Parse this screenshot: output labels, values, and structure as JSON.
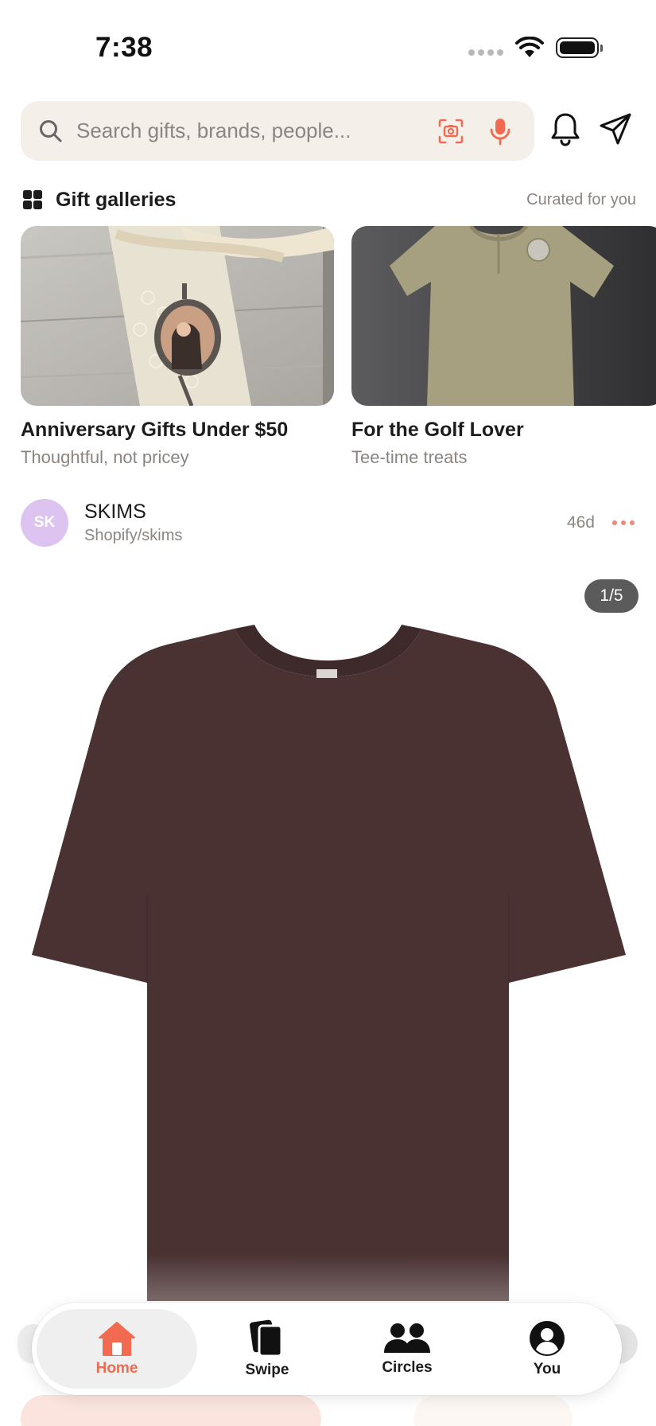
{
  "status_bar": {
    "time": "7:38"
  },
  "search": {
    "placeholder": "Search gifts, brands, people..."
  },
  "galleries": {
    "title": "Gift galleries",
    "subtitle": "Curated for you",
    "cards": [
      {
        "title": "Anniversary Gifts Under $50",
        "subtitle": "Thoughtful, not pricey"
      },
      {
        "title": "For the Golf Lover",
        "subtitle": "Tee-time treats"
      }
    ]
  },
  "post": {
    "avatar_initials": "SK",
    "name": "SKIMS",
    "handle": "Shopify/skims",
    "age": "46d",
    "image_counter": "1/5"
  },
  "bottom_nav": {
    "items": [
      {
        "label": "Home",
        "icon": "home-icon",
        "active": true
      },
      {
        "label": "Swipe",
        "icon": "cards-icon",
        "active": false
      },
      {
        "label": "Circles",
        "icon": "people-icon",
        "active": false
      },
      {
        "label": "You",
        "icon": "user-icon",
        "active": false
      }
    ]
  },
  "colors": {
    "accent": "#f26a4f",
    "search_bg": "#f5efe9",
    "avatar_bg": "#dcc3f0",
    "product_shirt": "#4a3132"
  }
}
